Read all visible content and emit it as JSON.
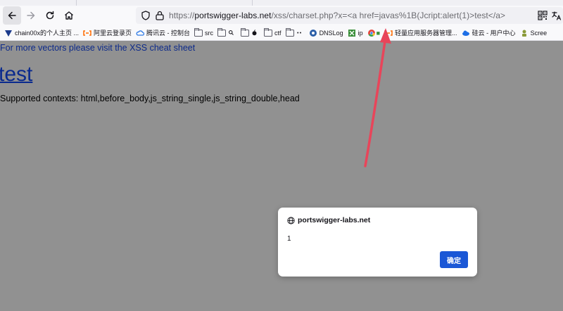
{
  "browser": {
    "url_prefix": "https://",
    "url_host": "portswigger-labs.net",
    "url_rest": "/xss/charset.php?x=<a href=javas%1B(Jcript:alert(1)>test</a>"
  },
  "bookmarks": [
    {
      "label": "chain00x的个人主页 ...",
      "icon": "v-logo-icon",
      "color": "#1b3a8c"
    },
    {
      "label": "阿里云登录页",
      "icon": "aliyun-icon",
      "color": "#ff6a00"
    },
    {
      "label": "腾讯云 - 控制台",
      "icon": "tencent-cloud-icon",
      "color": "#2e7ae6"
    },
    {
      "label": "src",
      "icon": "folder-icon"
    },
    {
      "label": "",
      "icon": "folder-search-icon"
    },
    {
      "label": "",
      "icon": "folder-apple-icon"
    },
    {
      "label": "ctf",
      "icon": "folder-icon"
    },
    {
      "label": "",
      "icon": "folder-dots-icon"
    },
    {
      "label": "DNSLog",
      "icon": "dnslog-icon",
      "color": "#2c5fa8"
    },
    {
      "label": "ip",
      "icon": "ip-icon",
      "color": "#3a8f3a"
    },
    {
      "label": "",
      "icon": "chrome-icon"
    },
    {
      "label": "轻量应用服务器管理...",
      "icon": "aliyun-icon",
      "color": "#ff6a00"
    },
    {
      "label": "硅云 - 用户中心",
      "icon": "cloud-icon",
      "color": "#1e6fe6"
    },
    {
      "label": "Scree",
      "icon": "screen-icon",
      "color": "#8b9b3a"
    }
  ],
  "page": {
    "top_link": "For more vectors please visit the XSS cheat sheet",
    "test_link": "test",
    "contexts": "Supported contexts: html,before_body,js_string_single,js_string_double,head"
  },
  "dialog": {
    "origin": "portswigger-labs.net",
    "message": "1",
    "ok_label": "确定"
  },
  "colors": {
    "accent": "#1a57d6",
    "annotation_arrow": "#e8455a",
    "page_overlay": "#919191"
  }
}
